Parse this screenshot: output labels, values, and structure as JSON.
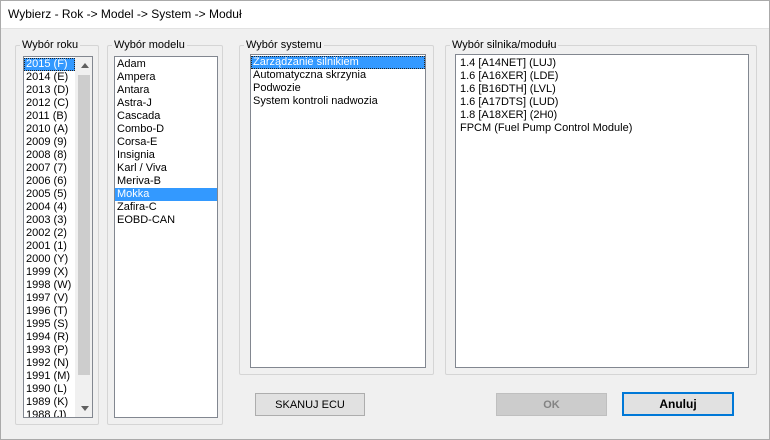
{
  "window": {
    "title": "Wybierz - Rok -> Model -> System -> Moduł"
  },
  "year": {
    "label": "Wybór roku",
    "items": [
      "2015 (F)",
      "2014 (E)",
      "2013 (D)",
      "2012 (C)",
      "2011 (B)",
      "2010 (A)",
      "2009 (9)",
      "2008 (8)",
      "2007 (7)",
      "2006 (6)",
      "2005 (5)",
      "2004 (4)",
      "2003 (3)",
      "2002 (2)",
      "2001 (1)",
      "2000 (Y)",
      "1999 (X)",
      "1998 (W)",
      "1997 (V)",
      "1996 (T)",
      "1995 (S)",
      "1994 (R)",
      "1993 (P)",
      "1992 (N)",
      "1991 (M)",
      "1990 (L)",
      "1989 (K)",
      "1988 (J)"
    ],
    "selected": "2015 (F)"
  },
  "model": {
    "label": "Wybór modelu",
    "items": [
      "Adam",
      "Ampera",
      "Antara",
      "Astra-J",
      "Cascada",
      "Combo-D",
      "Corsa-E",
      "Insignia",
      "Karl / Viva",
      "Meriva-B",
      "Mokka",
      "Zafira-C",
      "EOBD-CAN"
    ],
    "selected": "Mokka"
  },
  "system": {
    "label": "Wybór systemu",
    "items": [
      "Zarządzanie silnikiem",
      "Automatyczna skrzynia",
      "Podwozie",
      "System kontroli nadwozia"
    ],
    "selected": "Zarządzanie silnikiem"
  },
  "engine": {
    "label": "Wybór silnika/modułu",
    "items": [
      "1.4 [A14NET] (LUJ)",
      "1.6 [A16XER] (LDE)",
      "1.6 [B16DTH] (LVL)",
      "1.6 [A17DTS] (LUD)",
      "1.8 [A18XER] (2H0)",
      "FPCM (Fuel Pump Control Module)"
    ]
  },
  "buttons": {
    "scan": "SKANUJ ECU",
    "ok": "OK",
    "cancel": "Anuluj"
  },
  "colors": {
    "selection": "#3399ff",
    "primary_border": "#0078d7"
  }
}
